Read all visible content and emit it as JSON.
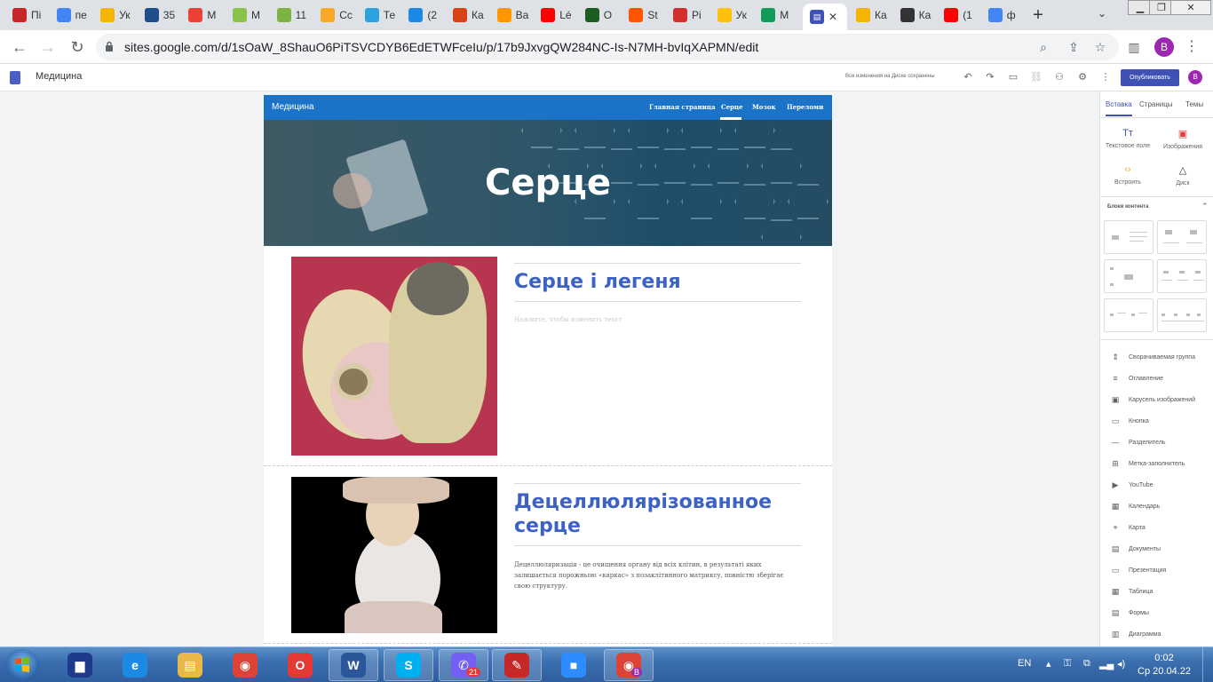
{
  "browser": {
    "tabs": [
      {
        "label": "Пі",
        "icon": "red-favicon",
        "color": "#c62828"
      },
      {
        "label": "пе",
        "icon": "google-icon",
        "color": "#4285f4"
      },
      {
        "label": "Ук",
        "icon": "hand-favicon",
        "color": "#f4b400"
      },
      {
        "label": "35",
        "icon": "blue-circle-favicon",
        "color": "#1e4e8c"
      },
      {
        "label": "М",
        "icon": "gmail-icon",
        "color": "#ea4335"
      },
      {
        "label": "М",
        "icon": "green-c-favicon",
        "color": "#8bc34a"
      },
      {
        "label": "11",
        "icon": "green-favicon",
        "color": "#7cb342"
      },
      {
        "label": "Сс",
        "icon": "classroom-icon",
        "color": "#f9a825"
      },
      {
        "label": "Те",
        "icon": "telegram-icon",
        "color": "#2aa3df"
      },
      {
        "label": "(2",
        "icon": "s-favicon",
        "color": "#1e88e5"
      },
      {
        "label": "Ка",
        "icon": "cal-favicon",
        "color": "#d84315"
      },
      {
        "label": "Ва",
        "icon": "web-favicon",
        "color": "#ff9800"
      },
      {
        "label": "Lé",
        "icon": "youtube-icon",
        "color": "#ff0000"
      },
      {
        "label": "О",
        "icon": "dark-favicon",
        "color": "#1b5e20"
      },
      {
        "label": "St",
        "icon": "soundcloud-icon",
        "color": "#ff5500"
      },
      {
        "label": "Рі",
        "icon": "flag-favicon",
        "color": "#d32f2f"
      },
      {
        "label": "Ук",
        "icon": "flag-favicon",
        "color": "#ffc107"
      },
      {
        "label": "М",
        "icon": "drive-icon",
        "color": "#0f9d58"
      }
    ],
    "active_tab": {
      "label": "",
      "icon": "sites-icon",
      "close": "✕"
    },
    "tabs_after": [
      {
        "label": "Ка",
        "icon": "slides-icon",
        "color": "#f4b400"
      },
      {
        "label": "Ка",
        "icon": "globe-icon",
        "color": "#333333"
      },
      {
        "label": "(1",
        "icon": "youtube-icon",
        "color": "#ff0000"
      },
      {
        "label": "ф",
        "icon": "google-icon",
        "color": "#4285f4"
      }
    ],
    "new_tab": "+",
    "url": "sites.google.com/d/1sOaW_8ShauO6PiTSVCDYB6EdETWFceIu/p/17b9JxvgQW284NC-Is-N7MH-bvIqXAPMN/edit",
    "profile_initial": "B"
  },
  "editor": {
    "site_name": "Медицина",
    "save_status": "Все изменения на Диске сохранены",
    "publish_label": "Опубликовать",
    "avatar_initial": "B"
  },
  "site": {
    "title": "Медицина",
    "nav": [
      "Главная страница",
      "Серце",
      "Мозок",
      "Переломи"
    ],
    "active_nav": "Серце",
    "hero_title": "Серце",
    "block1": {
      "heading": "Серце і легеня",
      "placeholder": "Нажмите, чтобы изменить текст"
    },
    "block2": {
      "heading": "Децеллюлярізованное серце",
      "body": "Децеллюляризація - це очищення органу від всіх клітин, в результаті яких залишається порожньою «каркас» з позаклітинного матриксу, повністю зберігає свою структуру."
    }
  },
  "panel": {
    "tabs": [
      "Вставка",
      "Страницы",
      "Темы"
    ],
    "active_tab": "Вставка",
    "tools": [
      {
        "label": "Текстовое поле",
        "icon": "text-box-icon",
        "glyph": "Tт",
        "color": "#3f51b5"
      },
      {
        "label": "Изображения",
        "icon": "image-icon",
        "glyph": "▣",
        "color": "#e53935"
      },
      {
        "label": "Встроить",
        "icon": "embed-icon",
        "glyph": "‹›",
        "color": "#f9a825"
      },
      {
        "label": "Диск",
        "icon": "drive-icon",
        "glyph": "△",
        "color": "#333333"
      }
    ],
    "blocks_header": "Блоки контента",
    "items": [
      {
        "label": "Сворачиваемая группа",
        "icon": "collapsible-icon",
        "glyph": "⇕"
      },
      {
        "label": "Оглавление",
        "icon": "toc-icon",
        "glyph": "≡"
      },
      {
        "label": "Карусель изображений",
        "icon": "carousel-icon",
        "glyph": "▣"
      },
      {
        "label": "Кнопка",
        "icon": "button-icon",
        "glyph": "▭"
      },
      {
        "label": "Разделитель",
        "icon": "divider-icon",
        "glyph": "—"
      },
      {
        "label": "Метка-заполнитель",
        "icon": "placeholder-icon",
        "glyph": "⊞"
      },
      {
        "label": "YouTube",
        "icon": "youtube-icon",
        "glyph": "▶"
      },
      {
        "label": "Календарь",
        "icon": "calendar-icon",
        "glyph": "▦"
      },
      {
        "label": "Карта",
        "icon": "map-pin-icon",
        "glyph": "⌖"
      },
      {
        "label": "Документы",
        "icon": "docs-icon",
        "glyph": "▤"
      },
      {
        "label": "Презентация",
        "icon": "slides-icon",
        "glyph": "▭"
      },
      {
        "label": "Таблица",
        "icon": "sheets-icon",
        "glyph": "▦"
      },
      {
        "label": "Формы",
        "icon": "forms-icon",
        "glyph": "▤"
      },
      {
        "label": "Диаграмма",
        "icon": "chart-icon",
        "glyph": "▥"
      }
    ]
  },
  "taskbar": {
    "language": "EN",
    "time": "0:02",
    "date": "Ср 20.04.22",
    "viber_badge": "21",
    "chrome_badge": "B",
    "apps": [
      {
        "name": "save-app-icon",
        "color": "#1e3a8a",
        "glyph": "▆"
      },
      {
        "name": "internet-explorer-icon",
        "color": "#1e88e5",
        "glyph": "e"
      },
      {
        "name": "file-explorer-icon",
        "color": "#e8b84a",
        "glyph": "▤"
      },
      {
        "name": "chrome-icon",
        "color": "#db4437",
        "glyph": "◉"
      },
      {
        "name": "opera-icon",
        "color": "#e53935",
        "glyph": "O"
      },
      {
        "name": "word-icon",
        "color": "#2b579a",
        "glyph": "W"
      },
      {
        "name": "skype-icon",
        "color": "#00aff0",
        "glyph": "S"
      },
      {
        "name": "viber-icon",
        "color": "#7360f2",
        "glyph": "✆"
      },
      {
        "name": "pdf-app-icon",
        "color": "#c62828",
        "glyph": "✎"
      },
      {
        "name": "zoom-icon",
        "color": "#2d8cff",
        "glyph": "■"
      },
      {
        "name": "chrome-profile-icon",
        "color": "#db4437",
        "glyph": "◉"
      }
    ]
  }
}
